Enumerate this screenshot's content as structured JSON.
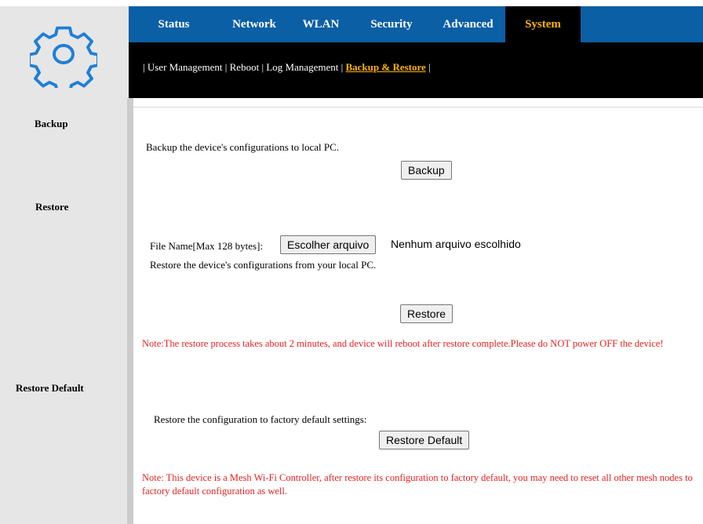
{
  "header": {
    "tabs": [
      {
        "label": "Status"
      },
      {
        "label": "Network"
      },
      {
        "label": "WLAN"
      },
      {
        "label": "Security"
      },
      {
        "label": "Advanced"
      },
      {
        "label": "System",
        "active": true
      }
    ],
    "subnav": {
      "sep": "|",
      "items": [
        "User Management",
        "Reboot",
        "Log Management",
        "Backup & Restore"
      ],
      "active": "Backup & Restore"
    }
  },
  "logo": {
    "icon": "gear-icon"
  },
  "sidebar": {
    "backup": "Backup",
    "restore": "Restore",
    "restore_default": "Restore Default"
  },
  "backup": {
    "description": "Backup the device's configurations to local PC.",
    "button": "Backup"
  },
  "restore": {
    "file_label": "File Name[Max 128 bytes]:",
    "file_button": "Escolher arquivo",
    "file_status": "Nenhum arquivo escolhido",
    "description": "Restore the device's configurations from your local PC.",
    "button": "Restore",
    "note": "Note:The restore process takes about 2 minutes, and device will reboot after restore complete.Please do NOT power OFF the device!"
  },
  "restore_default": {
    "description": "Restore the configuration to factory default settings:",
    "button": "Restore Default",
    "note": "Note: This device is a Mesh Wi-Fi Controller, after restore its configuration to factory default, you may need to reset all other mesh nodes to factory default configuration as well."
  },
  "colors": {
    "nav_bg": "#0b5fa5",
    "active_tab": "#ffb400",
    "note_red": "#e52222",
    "sidebar_bg": "#e6e6e6"
  }
}
